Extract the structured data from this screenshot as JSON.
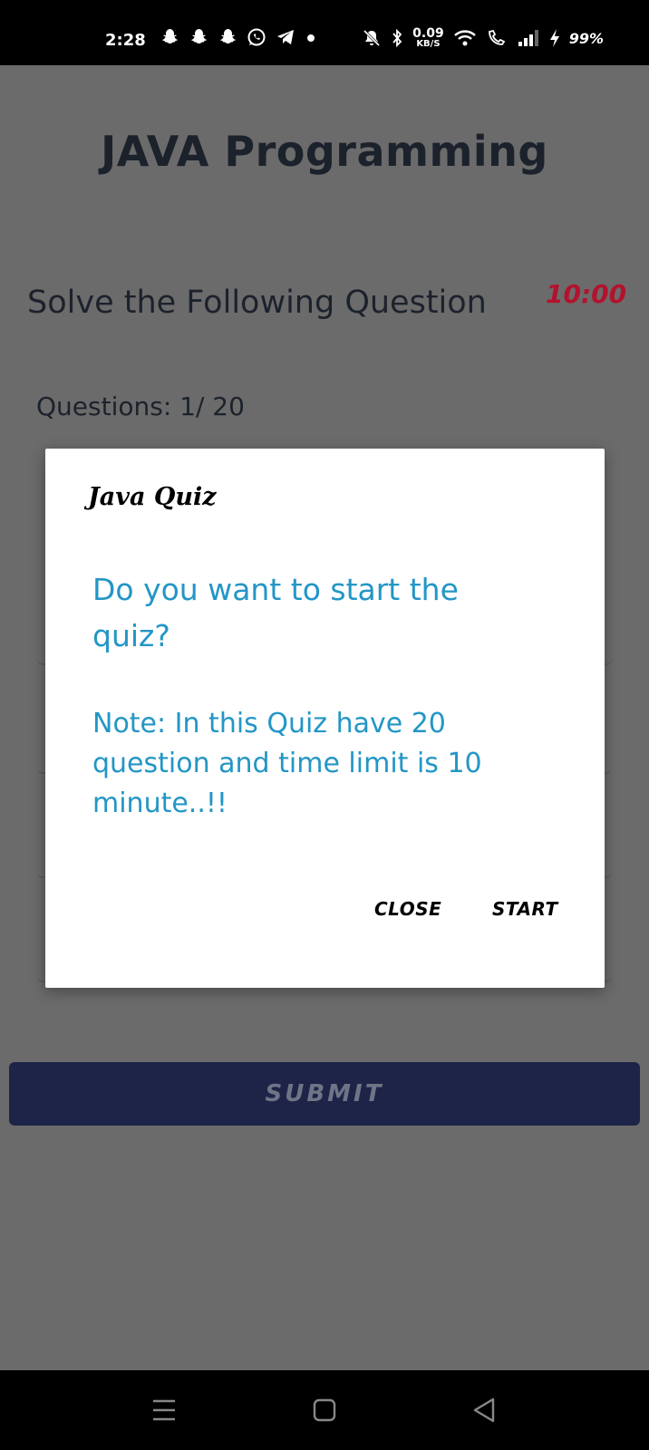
{
  "status_bar": {
    "time": "2:28",
    "left_icons": [
      "snapchat-icon",
      "snapchat-icon",
      "snapchat-icon",
      "whatsapp-icon",
      "telegram-icon",
      "dot-icon"
    ],
    "speed_value": "0.09",
    "speed_unit": "KB/S",
    "battery": "99%"
  },
  "app": {
    "title": "JAVA Programming",
    "section_title": "Solve the Following Question",
    "timer": "10:00",
    "question_count": "Questions: 1/ 20",
    "submit_label": "SUBMIT"
  },
  "dialog": {
    "title": "Java Quiz",
    "message": "Do you want to start the quiz?",
    "note": "Note: In this Quiz have 20 question and time limit is 10 minute..!!",
    "close_label": "CLOSE",
    "start_label": "START"
  },
  "colors": {
    "overlay": "#6b6b6b",
    "accent_text": "#2396c6",
    "timer": "#b3122d",
    "submit_bg": "#1d2447"
  }
}
